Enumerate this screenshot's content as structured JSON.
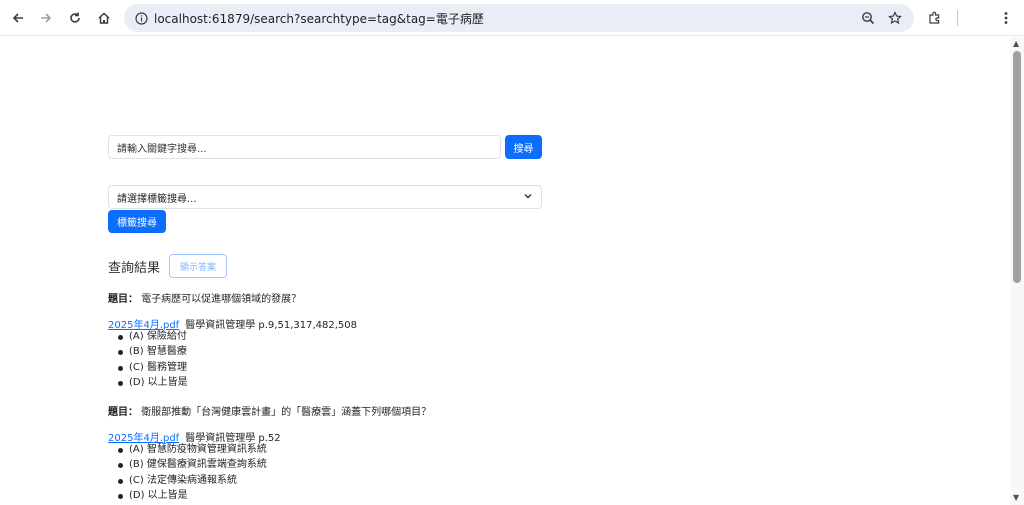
{
  "browser": {
    "url": "localhost:61879/search?searchtype=tag&tag=電子病歷"
  },
  "search": {
    "placeholder": "請輸入關鍵字搜尋...",
    "button_label": "搜尋"
  },
  "tag_search": {
    "selected": "請選擇標籤搜尋...",
    "button_label": "標籤搜尋"
  },
  "results": {
    "title": "查詢結果",
    "show_answer_label": "顯示答案",
    "questions": [
      {
        "prefix": "題目：",
        "text": "電子病歷可以促進哪個領域的發展？",
        "source_link": "2025年4月.pdf",
        "source_text": "醫學資訊管理學 p.9,51,317,482,508",
        "options": [
          "(A) 保險給付",
          "(B) 智慧醫療",
          "(C) 醫務管理",
          "(D) 以上皆是"
        ]
      },
      {
        "prefix": "題目：",
        "text": "衛服部推動「台灣健康雲計畫」的「醫療雲」涵蓋下列哪個項目？",
        "source_link": "2025年4月.pdf",
        "source_text": "醫學資訊管理學 p.52",
        "options": [
          "(A) 智慧防疫物資管理資訊系統",
          "(B) 健保醫療資訊雲端查詢系統",
          "(C) 法定傳染病通報系統",
          "(D) 以上皆是"
        ]
      }
    ]
  }
}
